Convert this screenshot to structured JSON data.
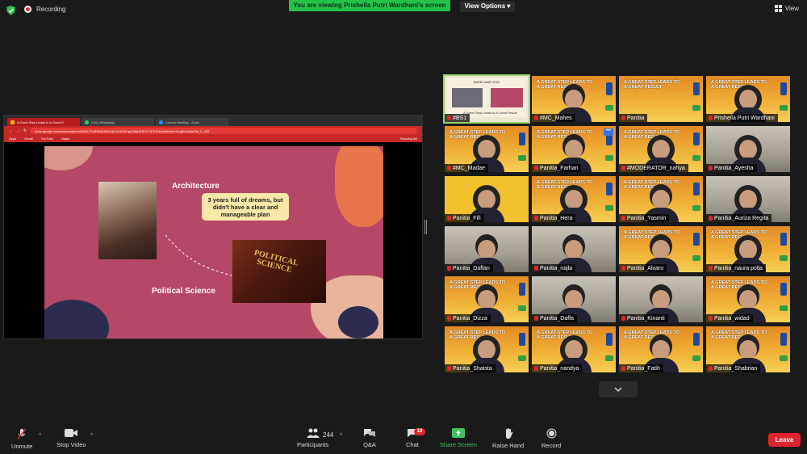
{
  "topbar": {
    "recording_label": "Recording",
    "viewing_banner": "You are viewing Prisheila Putri Wardhani's screen",
    "view_options": "View Options",
    "view_label": "View"
  },
  "shared_screen": {
    "tabs": [
      "A Great Step Leads to A Great R",
      "(131) WhatsApp",
      "Launch Meeting - Zoom"
    ],
    "url": "docs.google.com/presentation/d/10KUTmREDsOlkzCqTn1HcSk igLV6pU01FhYJZ7oF4/edit#slide=id.gf0c1dda43a_0_102",
    "bookmarks": [
      "Apps",
      "Gmail",
      "YouTube",
      "Maps"
    ],
    "reading_list": "Reading list",
    "slide": {
      "architecture": "Architecture",
      "bubble_text": "3 years full of dreams, but didn't have a clear and manageable plan",
      "political_science": "Political Science",
      "book_title": "POLITICAL SCIENCE"
    }
  },
  "gallery": {
    "screen_card_title": "BASECAMP 2022",
    "screen_card_caption": "A Great Step Leads to A Great Result",
    "banner_text": "A GREAT STEP LEADS TO A GREAT RESULT",
    "more_button": "•••",
    "participants": [
      "#BS1",
      "#MC_Mahes",
      "Panitia",
      "Prisheila Putri Wardhani",
      "#MC_Madae",
      "Panitia_Farhan",
      "#MODERATOR_nahya",
      "Panitia_Ayesha",
      "Panitia_Fifi",
      "Panitia_Hera",
      "Panitia_Yasmin",
      "Panitia_Auriza Regita",
      "Panitia_Daffan",
      "Panitia_najla",
      "Panitia_Alvaro",
      "Panitia_naura polla",
      "Panitia_Dizza",
      "Panitia_Daffa",
      "Panitia_Kinanti",
      "Panitia_widad",
      "Panitia_Shaista",
      "Panitia_nandya",
      "Panitia_Fatih",
      "Panitia_Shabrian"
    ]
  },
  "toolbar": {
    "unmute": "Unmute",
    "stop_video": "Stop Video",
    "participants": "Participants",
    "participants_count": "244",
    "qa": "Q&A",
    "chat": "Chat",
    "chat_badge": "19",
    "share_screen": "Share Screen",
    "raise_hand": "Raise Hand",
    "record": "Record",
    "leave": "Leave"
  },
  "colors": {
    "viewing_banner": "#23c349",
    "share_screen": "#40c463",
    "leave": "#e0242f",
    "slide_bg": "#b54866",
    "browser_chrome": "#c62828"
  },
  "icons": [
    "shield-icon",
    "recording-icon",
    "grid-view-icon",
    "microphone-muted-icon",
    "video-camera-icon",
    "participants-icon",
    "qa-icon",
    "chat-icon",
    "share-screen-icon",
    "raise-hand-icon",
    "record-icon",
    "chevron-down-icon"
  ]
}
